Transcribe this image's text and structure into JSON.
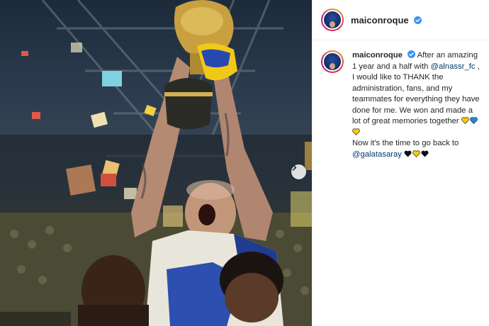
{
  "post": {
    "username": "maiconroque",
    "verified": true,
    "caption": {
      "text_1": "After an amazing 1 year and a half with",
      "mention_1": "@alnassr_fc",
      "text_2": ", I would like to THANK the administration, fans, and my teammates for everything they have done for me. We won and made a lot of great memories together",
      "text_3": "Now it's the time to go back to",
      "mention_2": "@galatasaray",
      "hearts_1": [
        "yellow",
        "blue",
        "yellow"
      ],
      "hearts_2": [
        "black",
        "yellow",
        "black"
      ]
    }
  },
  "colors": {
    "verified_blue": "#3897f0",
    "heart_yellow": "#ffcc00",
    "heart_blue": "#1e88e5",
    "heart_black": "#111111",
    "mention": "#00376b"
  },
  "icons": {
    "carousel_next": "chevron-right-icon",
    "verified": "verified-badge-icon"
  }
}
